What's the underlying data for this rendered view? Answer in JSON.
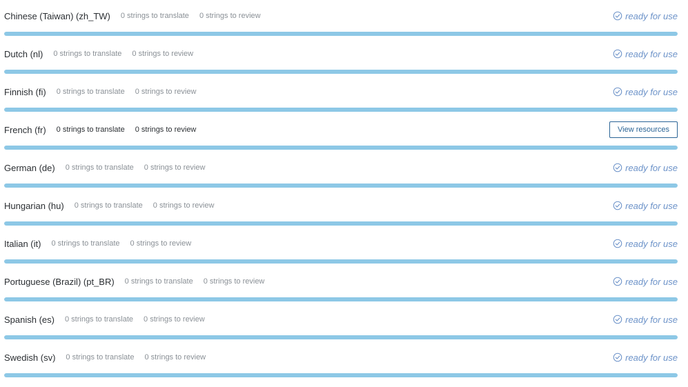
{
  "languages": [
    {
      "name": "Chinese (Taiwan) (zh_TW)",
      "to_translate": "0 strings to translate",
      "to_review": "0 strings to review",
      "status": "ready for use",
      "action": "",
      "progress": 1.0
    },
    {
      "name": "Dutch (nl)",
      "to_translate": "0 strings to translate",
      "to_review": "0 strings to review",
      "status": "ready for use",
      "action": "",
      "progress": 1.0
    },
    {
      "name": "Finnish (fi)",
      "to_translate": "0 strings to translate",
      "to_review": "0 strings to review",
      "status": "ready for use",
      "action": "",
      "progress": 1.0
    },
    {
      "name": "French (fr)",
      "to_translate": "0 strings to translate",
      "to_review": "0 strings to review",
      "status": "",
      "action": "View resources",
      "progress": 1.0
    },
    {
      "name": "German (de)",
      "to_translate": "0 strings to translate",
      "to_review": "0 strings to review",
      "status": "ready for use",
      "action": "",
      "progress": 1.0
    },
    {
      "name": "Hungarian (hu)",
      "to_translate": "0 strings to translate",
      "to_review": "0 strings to review",
      "status": "ready for use",
      "action": "",
      "progress": 1.0
    },
    {
      "name": "Italian (it)",
      "to_translate": "0 strings to translate",
      "to_review": "0 strings to review",
      "status": "ready for use",
      "action": "",
      "progress": 1.0
    },
    {
      "name": "Portuguese (Brazil) (pt_BR)",
      "to_translate": "0 strings to translate",
      "to_review": "0 strings to review",
      "status": "ready for use",
      "action": "",
      "progress": 1.0
    },
    {
      "name": "Spanish (es)",
      "to_translate": "0 strings to translate",
      "to_review": "0 strings to review",
      "status": "ready for use",
      "action": "",
      "progress": 1.0
    },
    {
      "name": "Swedish (sv)",
      "to_translate": "0 strings to translate",
      "to_review": "0 strings to review",
      "status": "ready for use",
      "action": "",
      "progress": 1.0
    }
  ],
  "icons": {
    "ready": "check-circle-icon"
  },
  "colors": {
    "progress": "#8dc8e6",
    "ready": "#6d93c9",
    "button": "#2a6496"
  }
}
